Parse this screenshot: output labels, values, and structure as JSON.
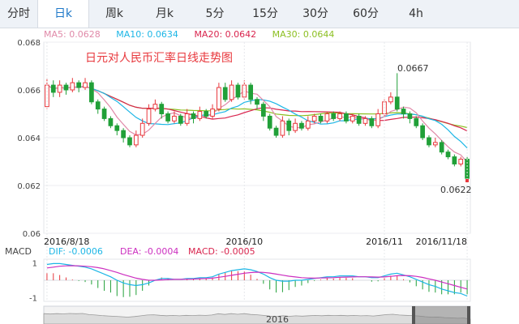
{
  "tabs": [
    {
      "label": "分时",
      "active": false
    },
    {
      "label": "日k",
      "active": true
    },
    {
      "label": "周k",
      "active": false
    },
    {
      "label": "月k",
      "active": false
    },
    {
      "label": "5分",
      "active": false
    },
    {
      "label": "15分",
      "active": false
    },
    {
      "label": "30分",
      "active": false
    },
    {
      "label": "60分",
      "active": false
    },
    {
      "label": "4h",
      "active": false
    }
  ],
  "legend": {
    "ma5": "MA5: 0.0628",
    "ma10": "MA10: 0.0634",
    "ma20": "MA20: 0.0642",
    "ma30": "MA30: 0.0644"
  },
  "colors": {
    "ma5": "#e089a8",
    "ma10": "#1cb6e6",
    "ma20": "#d9254e",
    "ma30": "#8cbf21",
    "up": "#e8383d",
    "down": "#21a038",
    "accent": "#1e78c8"
  },
  "chart_data": {
    "type": "candlestick",
    "title": "日元对人民币汇率日线走势图",
    "ylim": [
      0.06,
      0.068
    ],
    "yticks": [
      "0.068",
      "0.066",
      "0.064",
      "0.062",
      "0.06"
    ],
    "xticks": [
      {
        "label": "2016/8/18",
        "index": 0
      },
      {
        "label": "2016/10",
        "index": 31
      },
      {
        "label": "2016/11",
        "index": 53
      },
      {
        "label": "2016/11/18",
        "index": 66
      }
    ],
    "annotations": {
      "high": "0.0667",
      "low": "0.0622"
    },
    "candles": [
      [
        0.0653,
        0.0662,
        0.0665,
        0.0652
      ],
      [
        0.0662,
        0.0659,
        0.0664,
        0.0657
      ],
      [
        0.0659,
        0.0662,
        0.0664,
        0.0657
      ],
      [
        0.0662,
        0.066,
        0.0663,
        0.0658
      ],
      [
        0.066,
        0.0663,
        0.0665,
        0.0659
      ],
      [
        0.0663,
        0.0661,
        0.0664,
        0.0659
      ],
      [
        0.0661,
        0.0663,
        0.0665,
        0.066
      ],
      [
        0.0663,
        0.0655,
        0.0664,
        0.0654
      ],
      [
        0.0655,
        0.0652,
        0.0656,
        0.065
      ],
      [
        0.0652,
        0.0648,
        0.0653,
        0.0647
      ],
      [
        0.0648,
        0.0645,
        0.0649,
        0.0644
      ],
      [
        0.0645,
        0.0643,
        0.0646,
        0.0641
      ],
      [
        0.0643,
        0.064,
        0.0644,
        0.0638
      ],
      [
        0.064,
        0.0637,
        0.0641,
        0.0636
      ],
      [
        0.0637,
        0.0641,
        0.0643,
        0.0636
      ],
      [
        0.0641,
        0.0646,
        0.0648,
        0.064
      ],
      [
        0.0646,
        0.0652,
        0.0654,
        0.0645
      ],
      [
        0.0652,
        0.0654,
        0.0656,
        0.0651
      ],
      [
        0.0654,
        0.065,
        0.0655,
        0.0648
      ],
      [
        0.065,
        0.0647,
        0.0651,
        0.0646
      ],
      [
        0.0647,
        0.0649,
        0.0651,
        0.0646
      ],
      [
        0.0649,
        0.0646,
        0.065,
        0.0645
      ],
      [
        0.0646,
        0.065,
        0.0652,
        0.0645
      ],
      [
        0.065,
        0.0648,
        0.0651,
        0.0646
      ],
      [
        0.0648,
        0.0651,
        0.0653,
        0.0647
      ],
      [
        0.0651,
        0.0649,
        0.0652,
        0.0648
      ],
      [
        0.0649,
        0.0652,
        0.0654,
        0.0648
      ],
      [
        0.0652,
        0.0661,
        0.0663,
        0.0651
      ],
      [
        0.0661,
        0.0656,
        0.0663,
        0.0655
      ],
      [
        0.0656,
        0.0662,
        0.0664,
        0.0655
      ],
      [
        0.0662,
        0.0657,
        0.0663,
        0.0656
      ],
      [
        0.0657,
        0.0662,
        0.0664,
        0.0656
      ],
      [
        0.0662,
        0.0656,
        0.0663,
        0.0654
      ],
      [
        0.0656,
        0.0654,
        0.0657,
        0.0652
      ],
      [
        0.0654,
        0.0649,
        0.0655,
        0.0647
      ],
      [
        0.0649,
        0.0644,
        0.065,
        0.0643
      ],
      [
        0.0644,
        0.0641,
        0.0645,
        0.064
      ],
      [
        0.0641,
        0.0647,
        0.0649,
        0.064
      ],
      [
        0.0647,
        0.0643,
        0.0648,
        0.0641
      ],
      [
        0.0643,
        0.0646,
        0.0648,
        0.0642
      ],
      [
        0.0646,
        0.0644,
        0.0647,
        0.0643
      ],
      [
        0.0644,
        0.0647,
        0.0649,
        0.0643
      ],
      [
        0.0647,
        0.0649,
        0.065,
        0.0646
      ],
      [
        0.0649,
        0.0647,
        0.065,
        0.0646
      ],
      [
        0.0647,
        0.065,
        0.0651,
        0.0646
      ],
      [
        0.065,
        0.0648,
        0.0651,
        0.0647
      ],
      [
        0.0648,
        0.065,
        0.0651,
        0.0647
      ],
      [
        0.065,
        0.0647,
        0.0651,
        0.0646
      ],
      [
        0.0647,
        0.0649,
        0.065,
        0.0646
      ],
      [
        0.0649,
        0.0646,
        0.065,
        0.0645
      ],
      [
        0.0646,
        0.0648,
        0.0649,
        0.0645
      ],
      [
        0.0648,
        0.0645,
        0.0649,
        0.0644
      ],
      [
        0.0645,
        0.065,
        0.0652,
        0.0644
      ],
      [
        0.065,
        0.0655,
        0.0656,
        0.0649
      ],
      [
        0.0655,
        0.0657,
        0.0659,
        0.0654
      ],
      [
        0.0657,
        0.0652,
        0.0667,
        0.0651
      ],
      [
        0.0652,
        0.065,
        0.0653,
        0.0648
      ],
      [
        0.065,
        0.0648,
        0.0651,
        0.0646
      ],
      [
        0.0648,
        0.0645,
        0.0649,
        0.0644
      ],
      [
        0.0645,
        0.064,
        0.0646,
        0.0639
      ],
      [
        0.064,
        0.0637,
        0.0641,
        0.0636
      ],
      [
        0.0637,
        0.0638,
        0.064,
        0.0636
      ],
      [
        0.0638,
        0.0634,
        0.0639,
        0.0633
      ],
      [
        0.0634,
        0.0632,
        0.0635,
        0.0631
      ],
      [
        0.0632,
        0.0629,
        0.0633,
        0.0628
      ],
      [
        0.0629,
        0.0631,
        0.0632,
        0.0628
      ],
      [
        0.0631,
        0.0623,
        0.0632,
        0.0622
      ]
    ],
    "macd": {
      "legend": {
        "label": "MACD",
        "dif": "DIF: -0.0006",
        "dea": "DEA: -0.0004",
        "macd": "MACD: -0.0005"
      },
      "ylim": [
        -1.2,
        1.2
      ],
      "yticks": [
        "1",
        "-1"
      ],
      "dif": [
        0.9,
        0.95,
        0.95,
        0.9,
        0.85,
        0.8,
        0.75,
        0.65,
        0.5,
        0.35,
        0.2,
        0.0,
        -0.15,
        -0.25,
        -0.3,
        -0.25,
        -0.15,
        0.0,
        0.1,
        0.1,
        0.05,
        0.05,
        0.1,
        0.1,
        0.15,
        0.15,
        0.2,
        0.35,
        0.45,
        0.55,
        0.6,
        0.65,
        0.6,
        0.5,
        0.35,
        0.15,
        0.0,
        -0.05,
        -0.05,
        0.0,
        0.0,
        0.05,
        0.1,
        0.15,
        0.2,
        0.2,
        0.25,
        0.25,
        0.25,
        0.2,
        0.2,
        0.15,
        0.15,
        0.25,
        0.35,
        0.4,
        0.3,
        0.2,
        0.05,
        -0.1,
        -0.25,
        -0.35,
        -0.5,
        -0.6,
        -0.7,
        -0.75,
        -0.9
      ],
      "dea": [
        0.7,
        0.75,
        0.8,
        0.82,
        0.83,
        0.82,
        0.8,
        0.77,
        0.72,
        0.65,
        0.55,
        0.45,
        0.33,
        0.22,
        0.12,
        0.05,
        0.0,
        0.0,
        0.02,
        0.04,
        0.05,
        0.05,
        0.06,
        0.07,
        0.09,
        0.1,
        0.12,
        0.17,
        0.22,
        0.28,
        0.34,
        0.4,
        0.44,
        0.46,
        0.45,
        0.41,
        0.35,
        0.29,
        0.23,
        0.19,
        0.15,
        0.13,
        0.12,
        0.13,
        0.14,
        0.15,
        0.17,
        0.18,
        0.19,
        0.2,
        0.2,
        0.19,
        0.18,
        0.19,
        0.22,
        0.26,
        0.27,
        0.26,
        0.22,
        0.16,
        0.08,
        0.0,
        -0.1,
        -0.2,
        -0.3,
        -0.4,
        -0.5
      ]
    }
  },
  "navigator": {
    "year_label": "2016"
  }
}
